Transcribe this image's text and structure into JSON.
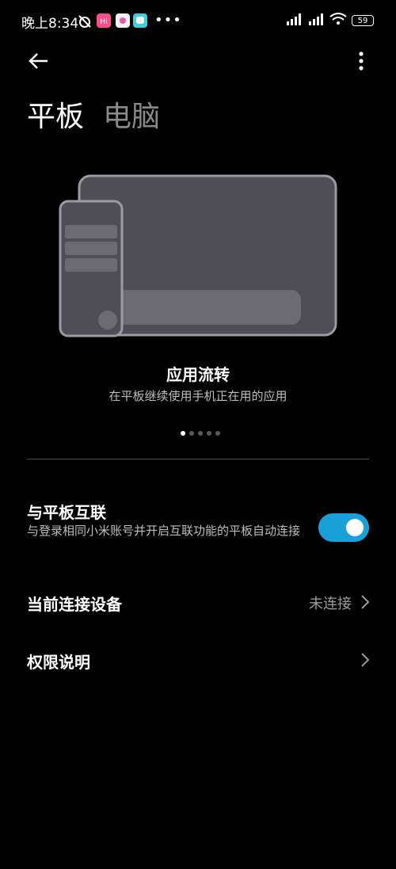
{
  "status_bar": {
    "time": "晚上8:34",
    "battery": "59",
    "app_icon_label": "Hi"
  },
  "header": {
    "back_icon": "arrow-left-icon",
    "more_icon": "more-vertical-icon"
  },
  "tabs": [
    {
      "label": "平板",
      "active": true
    },
    {
      "label": "电脑",
      "active": false
    }
  ],
  "feature": {
    "title": "应用流转",
    "subtitle": "在平板继续使用手机正在用的应用",
    "page_count": 5,
    "current_page": 1
  },
  "settings": {
    "interconnect": {
      "title": "与平板互联",
      "description": "与登录相同小米账号并开启互联功能的平板自动连接",
      "enabled": true
    },
    "current_device": {
      "title": "当前连接设备",
      "value": "未连接"
    },
    "permissions": {
      "title": "权限说明"
    }
  },
  "colors": {
    "background": "#000000",
    "accent_toggle": "#1aa0d8",
    "secondary_text": "#bdbdbd",
    "inactive_tab": "#8a8a8a"
  }
}
